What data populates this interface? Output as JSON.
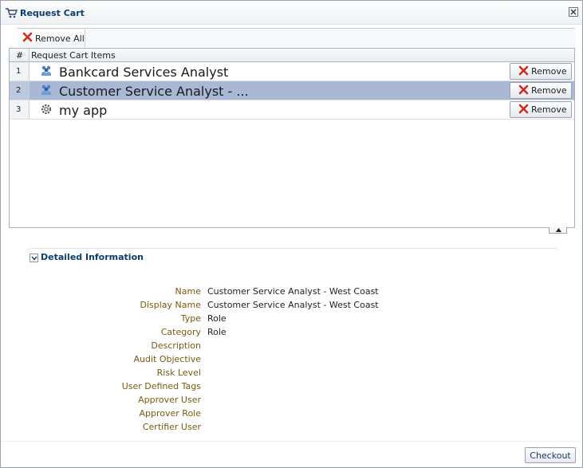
{
  "dialog": {
    "title": "Request Cart",
    "title_icon": "cart-icon",
    "close_icon": "close-icon"
  },
  "toolbar": {
    "remove_all_label": "Remove All"
  },
  "table": {
    "columns": [
      "#",
      "Request Cart Items"
    ],
    "rows": [
      {
        "num": "1",
        "name": "Bankcard Services Analyst",
        "icon": "role-icon",
        "selected": false,
        "remove_label": "Remove"
      },
      {
        "num": "2",
        "name": "Customer Service Analyst - ...",
        "icon": "role-icon",
        "selected": true,
        "remove_label": "Remove"
      },
      {
        "num": "3",
        "name": "my app",
        "icon": "app-gear-icon",
        "selected": false,
        "remove_label": "Remove"
      }
    ]
  },
  "detail": {
    "header": "Detailed Information",
    "fields": [
      {
        "label": "Name",
        "value": "Customer Service Analyst - West Coast"
      },
      {
        "label": "Display Name",
        "value": "Customer Service Analyst - West Coast"
      },
      {
        "label": "Type",
        "value": "Role"
      },
      {
        "label": "Category",
        "value": "Role"
      },
      {
        "label": "Description",
        "value": ""
      },
      {
        "label": "Audit Objective",
        "value": ""
      },
      {
        "label": "Risk Level",
        "value": ""
      },
      {
        "label": "User Defined Tags",
        "value": ""
      },
      {
        "label": "Approver User",
        "value": ""
      },
      {
        "label": "Approver Role",
        "value": ""
      },
      {
        "label": "Certifier User",
        "value": ""
      }
    ]
  },
  "footer": {
    "checkout_label": "Checkout"
  },
  "colors": {
    "title_text": "#0b3d6e",
    "selected_row": "#a9b8d4",
    "field_label": "#7a5a10",
    "remove_red": "#d42a1e"
  }
}
